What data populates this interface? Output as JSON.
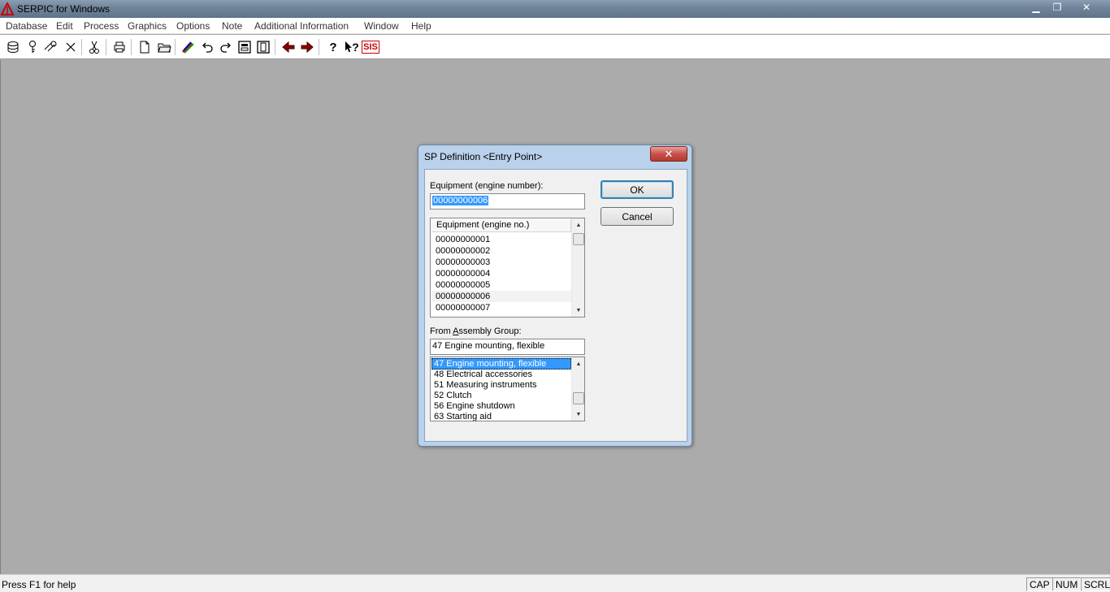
{
  "window": {
    "title": "SERPIC for Windows",
    "min_glyph": "▁",
    "max_glyph": "❐",
    "close_glyph": "✕"
  },
  "menu": {
    "items": [
      "Database",
      "Edit",
      "Process",
      "Graphics",
      "Options",
      "Note",
      "Additional Information",
      "Window",
      "Help"
    ]
  },
  "toolbar": {
    "sis_label": "SIS",
    "help_label": "?",
    "context_help_label": "?"
  },
  "dialog": {
    "title": "SP Definition <Entry Point>",
    "close_glyph": "✕",
    "equipment_label": "Equipment (engine number):",
    "equipment_value": "00000000006",
    "equipment_list_header": "Equipment (engine no.)",
    "equipment_items": [
      "00000000001",
      "00000000002",
      "00000000003",
      "00000000004",
      "00000000005",
      "00000000006",
      "00000000007"
    ],
    "assembly_label_pre": "From ",
    "assembly_label_underline": "A",
    "assembly_label_post": "ssembly Group:",
    "assembly_value": "47 Engine mounting, flexible",
    "assembly_items": [
      "47 Engine mounting, flexible",
      "48 Electrical accessories",
      "51 Measuring instruments",
      "52 Clutch",
      "56 Engine shutdown",
      "63 Starting aid"
    ],
    "ok_label": "OK",
    "cancel_label": "Cancel"
  },
  "status": {
    "help_text": "Press F1 for help",
    "cap": "CAP",
    "num": "NUM",
    "scrl": "SCRL"
  },
  "colors": {
    "selection": "#3399ff",
    "workspace": "#ababab"
  }
}
